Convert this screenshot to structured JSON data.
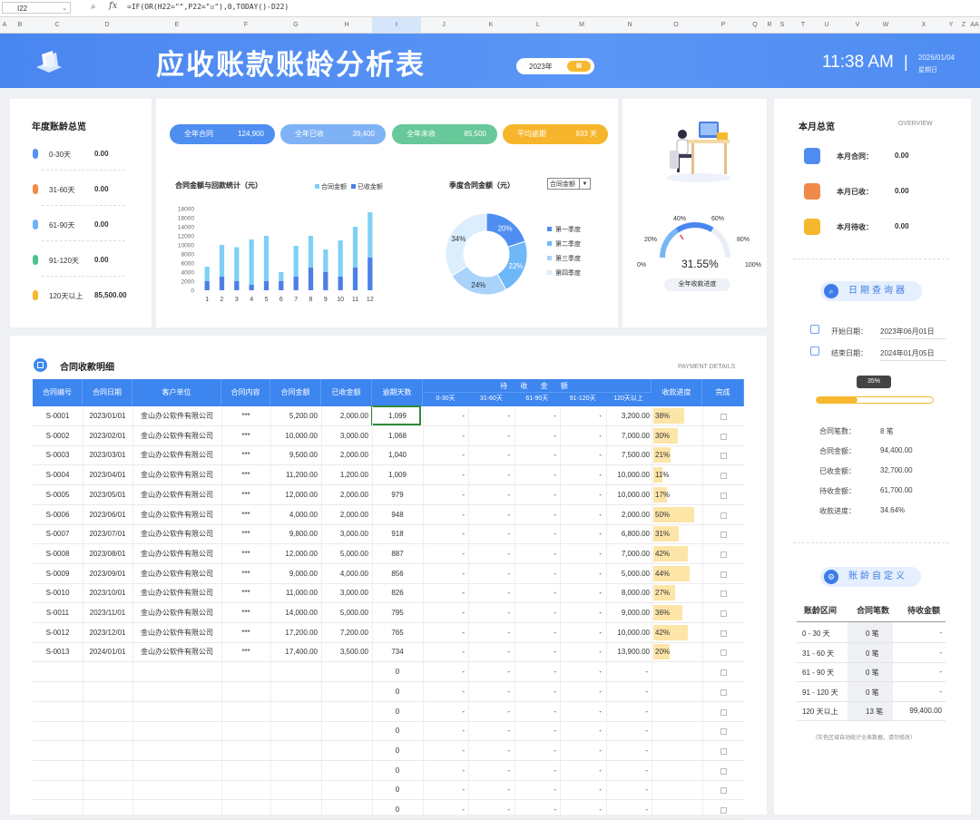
{
  "formula_bar": {
    "cell_ref": "I22",
    "formula": "=IF(OR(H22=\"\",P22=\"☑\"),0,TODAY()-D22)"
  },
  "columns": [
    "A",
    "B",
    "C",
    "D",
    "E",
    "F",
    "G",
    "H",
    "I",
    "J",
    "K",
    "L",
    "M",
    "N",
    "O",
    "P",
    "Q",
    "R",
    "S",
    "T",
    "U",
    "V",
    "W",
    "X",
    "Y",
    "Z",
    "AA"
  ],
  "header": {
    "title": "应收账款账龄分析表",
    "year": "2023年",
    "year_btn": "▦",
    "time": "11:38 AM",
    "sep": "|",
    "date": "2026/01/04",
    "weekday": "星期日"
  },
  "annual": {
    "title": "年度账龄总览",
    "rows": [
      {
        "label": "0-30天",
        "value": "0.00"
      },
      {
        "label": "31-60天",
        "value": "0.00"
      },
      {
        "label": "61-90天",
        "value": "0.00"
      },
      {
        "label": "91-120天",
        "value": "0.00"
      },
      {
        "label": "120天以上",
        "value": "85,500.00"
      }
    ]
  },
  "kpis": [
    {
      "label": "全年合同",
      "value": "124,900"
    },
    {
      "label": "全年已收",
      "value": "39,400"
    },
    {
      "label": "全年未收",
      "value": "85,500"
    },
    {
      "label": "平均逾期",
      "value": "933 天"
    }
  ],
  "bar_chart": {
    "title": "合同金额与回款统计（元）",
    "legend": [
      "合同金额",
      "已收金额"
    ]
  },
  "pie_chart": {
    "title": "季度合同金额（元）",
    "selector": "合同金额",
    "legend": [
      "第一季度",
      "第二季度",
      "第三季度",
      "第四季度"
    ]
  },
  "gauge": {
    "value": "31.55%",
    "caption": "全年收款进度",
    "ticks": [
      "0%",
      "20%",
      "40%",
      "60%",
      "80%",
      "100%"
    ]
  },
  "table": {
    "title": "合同收款明细",
    "subtitle": "PAYMENT DETAILS",
    "headers": [
      "合同编号",
      "合同日期",
      "客户单位",
      "合同内容",
      "合同金额",
      "已收金额",
      "逾期天数",
      "待 收 金 额",
      "收款进度",
      "完成"
    ],
    "sub_headers": [
      "0-30天",
      "31-60天",
      "61-90天",
      "91-120天",
      "120天以上"
    ],
    "rows": [
      {
        "id": "S-0001",
        "date": "2023/01/01",
        "client": "金山办公软件有限公司",
        "content": "***",
        "amount": "5,200.00",
        "received": "2,000.00",
        "overdue": "1,099",
        "b1": "-",
        "b2": "-",
        "b3": "-",
        "b4": "-",
        "b5": "3,200.00",
        "progress": "38%"
      },
      {
        "id": "S-0002",
        "date": "2023/02/01",
        "client": "金山办公软件有限公司",
        "content": "***",
        "amount": "10,000.00",
        "received": "3,000.00",
        "overdue": "1,068",
        "b1": "-",
        "b2": "-",
        "b3": "-",
        "b4": "-",
        "b5": "7,000.00",
        "progress": "30%"
      },
      {
        "id": "S-0003",
        "date": "2023/03/01",
        "client": "金山办公软件有限公司",
        "content": "***",
        "amount": "9,500.00",
        "received": "2,000.00",
        "overdue": "1,040",
        "b1": "-",
        "b2": "-",
        "b3": "-",
        "b4": "-",
        "b5": "7,500.00",
        "progress": "21%"
      },
      {
        "id": "S-0004",
        "date": "2023/04/01",
        "client": "金山办公软件有限公司",
        "content": "***",
        "amount": "11,200.00",
        "received": "1,200.00",
        "overdue": "1,009",
        "b1": "-",
        "b2": "-",
        "b3": "-",
        "b4": "-",
        "b5": "10,000.00",
        "progress": "11%"
      },
      {
        "id": "S-0005",
        "date": "2023/05/01",
        "client": "金山办公软件有限公司",
        "content": "***",
        "amount": "12,000.00",
        "received": "2,000.00",
        "overdue": "979",
        "b1": "-",
        "b2": "-",
        "b3": "-",
        "b4": "-",
        "b5": "10,000.00",
        "progress": "17%"
      },
      {
        "id": "S-0006",
        "date": "2023/06/01",
        "client": "金山办公软件有限公司",
        "content": "***",
        "amount": "4,000.00",
        "received": "2,000.00",
        "overdue": "948",
        "b1": "-",
        "b2": "-",
        "b3": "-",
        "b4": "-",
        "b5": "2,000.00",
        "progress": "50%"
      },
      {
        "id": "S-0007",
        "date": "2023/07/01",
        "client": "金山办公软件有限公司",
        "content": "***",
        "amount": "9,800.00",
        "received": "3,000.00",
        "overdue": "918",
        "b1": "-",
        "b2": "-",
        "b3": "-",
        "b4": "-",
        "b5": "6,800.00",
        "progress": "31%"
      },
      {
        "id": "S-0008",
        "date": "2023/08/01",
        "client": "金山办公软件有限公司",
        "content": "***",
        "amount": "12,000.00",
        "received": "5,000.00",
        "overdue": "887",
        "b1": "-",
        "b2": "-",
        "b3": "-",
        "b4": "-",
        "b5": "7,000.00",
        "progress": "42%"
      },
      {
        "id": "S-0009",
        "date": "2023/09/01",
        "client": "金山办公软件有限公司",
        "content": "***",
        "amount": "9,000.00",
        "received": "4,000.00",
        "overdue": "856",
        "b1": "-",
        "b2": "-",
        "b3": "-",
        "b4": "-",
        "b5": "5,000.00",
        "progress": "44%"
      },
      {
        "id": "S-0010",
        "date": "2023/10/01",
        "client": "金山办公软件有限公司",
        "content": "***",
        "amount": "11,000.00",
        "received": "3,000.00",
        "overdue": "826",
        "b1": "-",
        "b2": "-",
        "b3": "-",
        "b4": "-",
        "b5": "8,000.00",
        "progress": "27%"
      },
      {
        "id": "S-0011",
        "date": "2023/11/01",
        "client": "金山办公软件有限公司",
        "content": "***",
        "amount": "14,000.00",
        "received": "5,000.00",
        "overdue": "795",
        "b1": "-",
        "b2": "-",
        "b3": "-",
        "b4": "-",
        "b5": "9,000.00",
        "progress": "36%"
      },
      {
        "id": "S-0012",
        "date": "2023/12/01",
        "client": "金山办公软件有限公司",
        "content": "***",
        "amount": "17,200.00",
        "received": "7,200.00",
        "overdue": "765",
        "b1": "-",
        "b2": "-",
        "b3": "-",
        "b4": "-",
        "b5": "10,000.00",
        "progress": "42%"
      },
      {
        "id": "S-0013",
        "date": "2024/01/01",
        "client": "金山办公软件有限公司",
        "content": "***",
        "amount": "17,400.00",
        "received": "3,500.00",
        "overdue": "734",
        "b1": "-",
        "b2": "-",
        "b3": "-",
        "b4": "-",
        "b5": "13,900.00",
        "progress": "20%"
      }
    ],
    "empty_rows": {
      "overdue": "0",
      "dash": "-",
      "count": 8
    }
  },
  "month": {
    "title": "本月总览",
    "overview": "OVERVIEW",
    "rows": [
      {
        "label": "本月合同：",
        "value": "0.00"
      },
      {
        "label": "本月已收：",
        "value": "0.00"
      },
      {
        "label": "本月待收：",
        "value": "0.00"
      }
    ]
  },
  "query": {
    "title": "日期查询器",
    "start_label": "开始日期：",
    "start": "2023年06月01日",
    "end_label": "结束日期：",
    "end": "2024年01月05日",
    "progress_label": "35%",
    "progress": 0.35,
    "stats": [
      {
        "label": "合同笔数：",
        "value": "8 笔"
      },
      {
        "label": "合同金额：",
        "value": "94,400.00"
      },
      {
        "label": "已收金额：",
        "value": "32,700.00"
      },
      {
        "label": "待收金额：",
        "value": "61,700.00"
      },
      {
        "label": "收款进度：",
        "value": "34.64%"
      }
    ]
  },
  "aging": {
    "title": "账龄自定义",
    "headers": [
      "账龄区间",
      "合同笔数",
      "待收金额"
    ],
    "rows": [
      {
        "range": "0 - 30 天",
        "count": "0 笔",
        "amount": "-"
      },
      {
        "range": "31 - 60 天",
        "count": "0 笔",
        "amount": "-"
      },
      {
        "range": "61 - 90 天",
        "count": "0 笔",
        "amount": "-"
      },
      {
        "range": "91 - 120 天",
        "count": "0 笔",
        "amount": "-"
      },
      {
        "range": "120 天以上",
        "count": "13 笔",
        "amount": "99,400.00"
      }
    ],
    "note": "（灰色区域自动统计全表数据，请勿修改）"
  },
  "chart_data": [
    {
      "type": "bar",
      "title": "合同金额与回款统计（元）",
      "categories": [
        "1",
        "2",
        "3",
        "4",
        "5",
        "6",
        "7",
        "8",
        "9",
        "10",
        "11",
        "12"
      ],
      "series": [
        {
          "name": "合同金额",
          "values": [
            5200,
            10000,
            9500,
            11200,
            12000,
            4000,
            9800,
            12000,
            9000,
            11000,
            14000,
            17200
          ]
        },
        {
          "name": "已收金额",
          "values": [
            2000,
            3000,
            2000,
            1200,
            2000,
            2000,
            3000,
            5000,
            4000,
            3000,
            5000,
            7200
          ]
        }
      ],
      "ylim": [
        0,
        18000
      ],
      "yticks": [
        "0",
        "2000",
        "4000",
        "6000",
        "8000",
        "10000",
        "12000",
        "14000",
        "16000",
        "18000"
      ]
    },
    {
      "type": "pie",
      "title": "季度合同金额（元）",
      "categories": [
        "第一季度",
        "第二季度",
        "第三季度",
        "第四季度"
      ],
      "values": [
        20,
        22,
        24,
        34
      ]
    },
    {
      "type": "gauge",
      "value": 31.55,
      "range": [
        0,
        100
      ]
    }
  ],
  "colors": {
    "blue": "#3d86f0",
    "light_blue": "#7fd0f5",
    "green": "#67c89a",
    "orange": "#f7b52b",
    "annual_dots": [
      "#5b8ff2",
      "#ef8a4a",
      "#6eb3f7",
      "#4fc08b",
      "#f5b82e"
    ],
    "month_icons": [
      "#4e8cf0",
      "#ef8a4a",
      "#f5b82e"
    ],
    "kpi_colors": [
      "#4e8ef0",
      "#7fb2f5",
      "#67c89a",
      "#f7b52b"
    ],
    "pie_colors": [
      "#4e8ef0",
      "#6fb8f7",
      "#a9d3fa",
      "#dceefd"
    ]
  }
}
